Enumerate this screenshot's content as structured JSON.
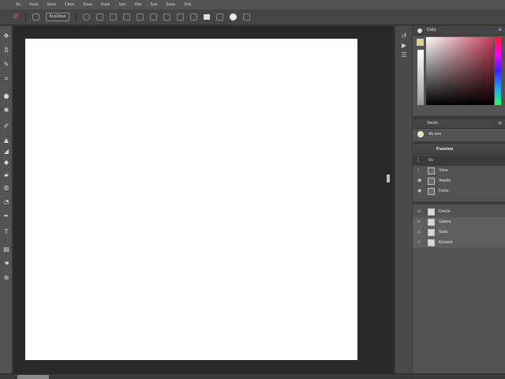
{
  "menu": [
    "Ss",
    "Vsse",
    "Ssse",
    "Cbse",
    "Ssse",
    "Vsse",
    "Sso",
    "Vse",
    "Sse",
    "Ssoe",
    "Dsk"
  ],
  "options": {
    "tool_icon": "eyedropper-icon",
    "preset_label": "AraOww"
  },
  "panels": {
    "color": {
      "tab": "Daty",
      "foreground": "#e8d080"
    },
    "adjust": {
      "tab": "Vauts",
      "sub": "Vo sve"
    },
    "layers": {
      "tab": "Fsaslen",
      "items": [
        {
          "label": "Vc",
          "selected": true
        },
        {
          "label": "Vsse",
          "selected": false
        },
        {
          "label": "Voede",
          "selected": false
        },
        {
          "label": "Dsho",
          "selected": false
        }
      ]
    },
    "history": {
      "items": [
        {
          "label": "Deste",
          "selected": false
        },
        {
          "label": "Gaera",
          "selected": true
        },
        {
          "label": "Ssse",
          "selected": true
        },
        {
          "label": "Kusase",
          "selected": true
        }
      ]
    }
  }
}
